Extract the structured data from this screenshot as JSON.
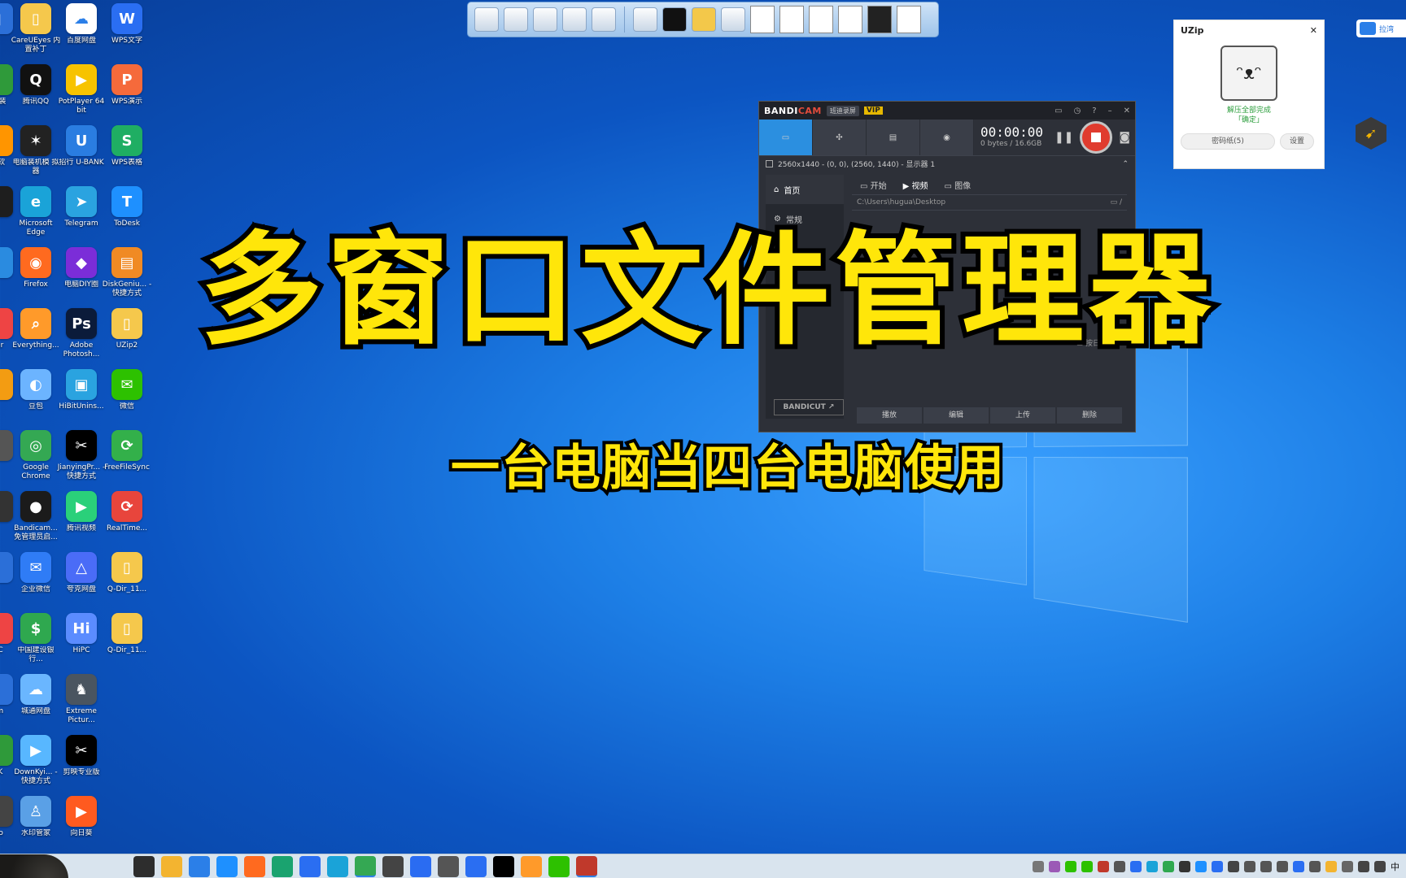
{
  "desktop": {
    "edge_col": [
      {
        "label": "",
        "color": "#2b6fd8",
        "glyph": "▮"
      },
      {
        "label": "软\n装",
        "color": "#2f9a3a",
        "glyph": ""
      },
      {
        "label": "文软",
        "color": "#ff9500",
        "glyph": ""
      },
      {
        "label": "",
        "color": "#1e1e1e",
        "glyph": ""
      },
      {
        "label": "",
        "color": "#2a8be0",
        "glyph": ""
      },
      {
        "label": "ver",
        "color": "#e44",
        "glyph": ""
      },
      {
        "label": "",
        "color": "#f39c12",
        "glyph": ""
      },
      {
        "label": "",
        "color": "#555",
        "glyph": ""
      },
      {
        "label": "",
        "color": "#333",
        "glyph": ""
      },
      {
        "label": "",
        "color": "#2b6fd8",
        "glyph": ""
      },
      {
        "label": "DC",
        "color": "#e44",
        "glyph": ""
      },
      {
        "label": "om",
        "color": "#2b6fd8",
        "glyph": ""
      },
      {
        "label": "UK",
        "color": "#2f9a3a",
        "glyph": ""
      },
      {
        "label": "dio",
        "color": "#444",
        "glyph": ""
      },
      {
        "label": "",
        "color": "#222",
        "glyph": ""
      }
    ],
    "col1": [
      {
        "label": "CareUEyes 内置补丁",
        "color": "#f5c84c",
        "glyph": "▯"
      },
      {
        "label": "腾讯QQ",
        "color": "#111",
        "glyph": "Q"
      },
      {
        "label": "电脑装机模 拟器",
        "color": "#222",
        "glyph": "✶"
      },
      {
        "label": "Microsoft Edge",
        "color": "#1aa3d8",
        "glyph": "e"
      },
      {
        "label": "Firefox",
        "color": "#ff6a1f",
        "glyph": "◉"
      },
      {
        "label": "Everything...",
        "color": "#ff9a2a",
        "glyph": "⌕"
      },
      {
        "label": "豆包",
        "color": "#6cb4ff",
        "glyph": "◐"
      },
      {
        "label": "Google Chrome",
        "color": "#34a853",
        "glyph": "◎"
      },
      {
        "label": "Bandicam... 免管理员启...",
        "color": "#1b1b1b",
        "glyph": "●"
      },
      {
        "label": "企业微信",
        "color": "#2f7cf6",
        "glyph": "✉"
      },
      {
        "label": "中国建设银 行...",
        "color": "#2fa84f",
        "glyph": "$"
      },
      {
        "label": "城通网盘",
        "color": "#6ab6ff",
        "glyph": "☁"
      },
      {
        "label": "DownKyi... - 快捷方式",
        "color": "#58b7ff",
        "glyph": "▶"
      },
      {
        "label": "水印管家",
        "color": "#5aa0e6",
        "glyph": "♙"
      }
    ],
    "col2": [
      {
        "label": "百度网盘",
        "color": "#ffffff",
        "glyph": "☁"
      },
      {
        "label": "PotPlayer 64 bit",
        "color": "#f7c300",
        "glyph": "▶"
      },
      {
        "label": "招行 U-BANK",
        "color": "#2a7de1",
        "glyph": "U"
      },
      {
        "label": "Telegram",
        "color": "#2aa3e0",
        "glyph": "➤"
      },
      {
        "label": "电脑DIY圈",
        "color": "#7b2dd8",
        "glyph": "◆"
      },
      {
        "label": "Adobe Photosh...",
        "color": "#0b1b3a",
        "glyph": "Ps"
      },
      {
        "label": "HiBitUnins...",
        "color": "#2aa3e0",
        "glyph": "▣"
      },
      {
        "label": "JianyingPr... - 快捷方式",
        "color": "#000",
        "glyph": "✂"
      },
      {
        "label": "腾讯视频",
        "color": "#2ad07a",
        "glyph": "▶"
      },
      {
        "label": "夸克网盘",
        "color": "#4a6cf7",
        "glyph": "△"
      },
      {
        "label": "HiPC",
        "color": "#5b8cff",
        "glyph": "Hi"
      },
      {
        "label": "Extreme Pictur...",
        "color": "#4a5560",
        "glyph": "♞"
      },
      {
        "label": "剪映专业版",
        "color": "#000",
        "glyph": "✂"
      },
      {
        "label": "向日葵",
        "color": "#ff5a1f",
        "glyph": "▶"
      }
    ],
    "col3": [
      {
        "label": "WPS文字",
        "color": "#2a6ef2",
        "glyph": "W"
      },
      {
        "label": "WPS演示",
        "color": "#f56a3b",
        "glyph": "P"
      },
      {
        "label": "WPS表格",
        "color": "#1fae63",
        "glyph": "S"
      },
      {
        "label": "ToDesk",
        "color": "#1e90ff",
        "glyph": "T"
      },
      {
        "label": "DiskGeniu... - 快捷方式",
        "color": "#f08a24",
        "glyph": "▤"
      },
      {
        "label": "UZip2",
        "color": "#f5c84c",
        "glyph": "▯"
      },
      {
        "label": "微信",
        "color": "#2dc100",
        "glyph": "✉"
      },
      {
        "label": "FreeFileSync",
        "color": "#33b04a",
        "glyph": "⟳"
      },
      {
        "label": "RealTime...",
        "color": "#e8453c",
        "glyph": "⟳"
      },
      {
        "label": "Q-Dir_11...",
        "color": "#f5c84c",
        "glyph": "▯"
      },
      {
        "label": "Q-Dir_11...",
        "color": "#f5c84c",
        "glyph": "▯"
      }
    ]
  },
  "bandicam": {
    "brand_a": "BANDI",
    "brand_b": "CAM",
    "tag": "班迪录屏",
    "vip": "VIP",
    "timer": "00:00:00",
    "bytes": "0 bytes / 16.6GB",
    "region": "2560x1440 - (0, 0), (2560, 1440) - 显示器 1",
    "side_home": "首页",
    "side_general": "常规",
    "tab_start": "开始",
    "tab_video": "视频",
    "tab_image": "图像",
    "path": "C:\\Users\\hugua\\Desktop",
    "sort": "按日期排序",
    "cut": "BANDICUT ↗",
    "actions": [
      "播放",
      "编辑",
      "上传",
      "删除"
    ]
  },
  "uzip": {
    "title": "UZip",
    "msg1": "解压全部完成",
    "msg2": "「确定」",
    "btn_pwd": "密码纸(5)",
    "btn_settings": "设置"
  },
  "cloud_label": "拉湾",
  "headline": "多窗口文件管理器",
  "subline": "一台电脑当四台电脑使用",
  "taskbar": {
    "ime": "中",
    "apps": [
      "#2d2d2d",
      "#f3b430",
      "#2b7fe8",
      "#1e90ff",
      "#ff6a1f",
      "#1aa36f",
      "#2a6ef2",
      "#1aa3d8",
      "#34a853",
      "#444",
      "#2a6cf2",
      "#555",
      "#2a6ef2",
      "#000",
      "#ff9a2a",
      "#2dc100",
      "#c0392b"
    ]
  }
}
